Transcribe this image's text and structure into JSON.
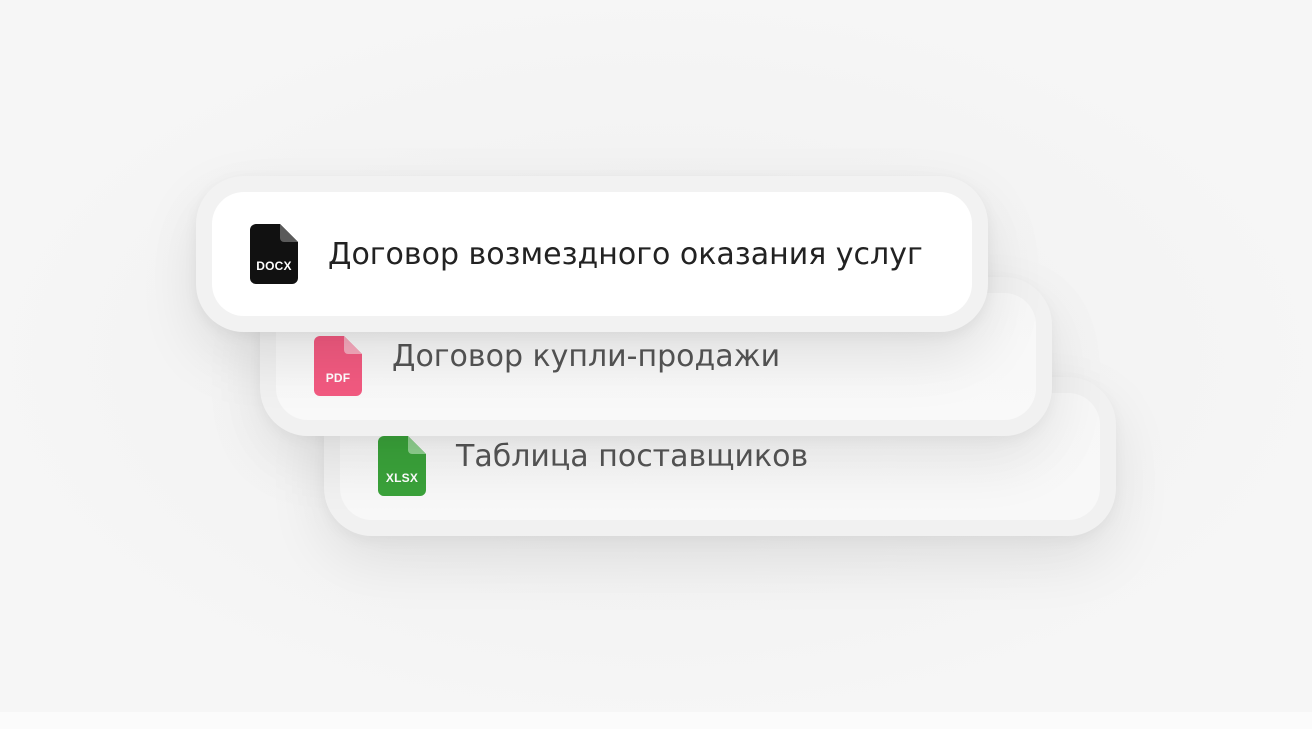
{
  "files": [
    {
      "type_label": "DOCX",
      "title": "Договор возмездного оказания услуг",
      "icon": "docx-file-icon",
      "color": "#111111",
      "fold_color": "#555555"
    },
    {
      "type_label": "PDF",
      "title": "Договор купли-продажи",
      "icon": "pdf-file-icon",
      "color": "#f25a80",
      "fold_color": "#f7a9bd"
    },
    {
      "type_label": "XLSX",
      "title": "Таблица поставщиков",
      "icon": "xlsx-file-icon",
      "color": "#3aa23a",
      "fold_color": "#8fd08f"
    }
  ]
}
